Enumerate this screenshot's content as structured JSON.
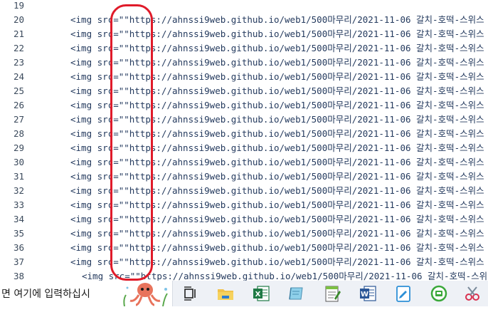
{
  "editor": {
    "lines": [
      {
        "number": "19",
        "text": ""
      },
      {
        "number": "20",
        "text": "<img src=\"\"https://ahnssi9web.github.io/web1/500마무리/2021-11-06 갈치-호떡-스위스"
      },
      {
        "number": "21",
        "text": "<img src=\"\"https://ahnssi9web.github.io/web1/500마무리/2021-11-06 갈치-호떡-스위스"
      },
      {
        "number": "22",
        "text": "<img src=\"\"https://ahnssi9web.github.io/web1/500마무리/2021-11-06 갈치-호떡-스위스"
      },
      {
        "number": "23",
        "text": "<img src=\"\"https://ahnssi9web.github.io/web1/500마무리/2021-11-06 갈치-호떡-스위스"
      },
      {
        "number": "24",
        "text": "<img src=\"\"https://ahnssi9web.github.io/web1/500마무리/2021-11-06 갈치-호떡-스위스"
      },
      {
        "number": "25",
        "text": "<img src=\"\"https://ahnssi9web.github.io/web1/500마무리/2021-11-06 갈치-호떡-스위스"
      },
      {
        "number": "26",
        "text": "<img src=\"\"https://ahnssi9web.github.io/web1/500마무리/2021-11-06 갈치-호떡-스위스"
      },
      {
        "number": "27",
        "text": "<img src=\"\"https://ahnssi9web.github.io/web1/500마무리/2021-11-06 갈치-호떡-스위스"
      },
      {
        "number": "28",
        "text": "<img src=\"\"https://ahnssi9web.github.io/web1/500마무리/2021-11-06 갈치-호떡-스위스"
      },
      {
        "number": "29",
        "text": "<img src=\"\"https://ahnssi9web.github.io/web1/500마무리/2021-11-06 갈치-호떡-스위스"
      },
      {
        "number": "30",
        "text": "<img src=\"\"https://ahnssi9web.github.io/web1/500마무리/2021-11-06 갈치-호떡-스위스"
      },
      {
        "number": "31",
        "text": "<img src=\"\"https://ahnssi9web.github.io/web1/500마무리/2021-11-06 갈치-호떡-스위스"
      },
      {
        "number": "32",
        "text": "<img src=\"\"https://ahnssi9web.github.io/web1/500마무리/2021-11-06 갈치-호떡-스위스"
      },
      {
        "number": "33",
        "text": "<img src=\"\"https://ahnssi9web.github.io/web1/500마무리/2021-11-06 갈치-호떡-스위스"
      },
      {
        "number": "34",
        "text": "<img src=\"\"https://ahnssi9web.github.io/web1/500마무리/2021-11-06 갈치-호떡-스위스"
      },
      {
        "number": "35",
        "text": "<img src=\"\"https://ahnssi9web.github.io/web1/500마무리/2021-11-06 갈치-호떡-스위스"
      },
      {
        "number": "36",
        "text": "<img src=\"\"https://ahnssi9web.github.io/web1/500마무리/2021-11-06 갈치-호떡-스위스"
      },
      {
        "number": "37",
        "text": "<img src=\"\"https://ahnssi9web.github.io/web1/500마무리/2021-11-06 갈치-호떡-스위스"
      },
      {
        "number": "38",
        "text": "<img src=\"\"https://ahnssi9web.github.io/web1/500마무리/2021-11-06 갈치-호떡-스위"
      }
    ]
  },
  "taskbar": {
    "search_placeholder": "면 여기에 입력하십시",
    "icons": [
      "octopus-search-decoration-icon",
      "task-view-icon",
      "file-explorer-icon",
      "excel-icon",
      "notepad-icon",
      "notepad-plus-icon",
      "word-icon",
      "edit-app-icon",
      "green-app-icon",
      "snipping-tool-icon"
    ]
  },
  "colors": {
    "highlight": "#e01b2a",
    "code_text": "#243a5e",
    "taskbar_bg": "#eef1f6"
  }
}
